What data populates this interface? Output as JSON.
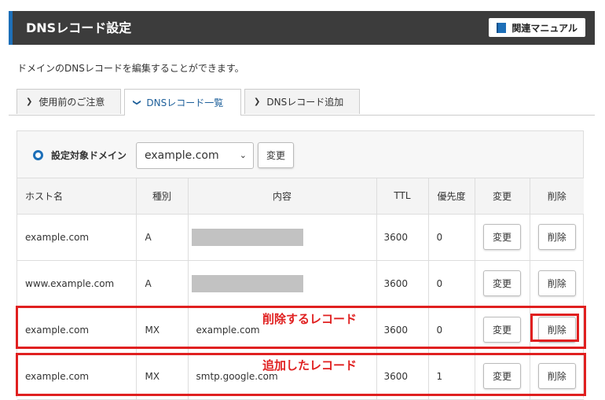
{
  "header": {
    "title": "DNSレコード設定",
    "manual_label": "関連マニュアル"
  },
  "description": "ドメインのDNSレコードを編集することができます。",
  "tabs": [
    {
      "label": "使用前のご注意",
      "active": false
    },
    {
      "label": "DNSレコード一覧",
      "active": true
    },
    {
      "label": "DNSレコード追加",
      "active": false
    }
  ],
  "domain_selector": {
    "label": "設定対象ドメイン",
    "value": "example.com",
    "button_label": "変更"
  },
  "table": {
    "headers": [
      "ホスト名",
      "種別",
      "内容",
      "TTL",
      "優先度",
      "変更",
      "削除"
    ],
    "rows": [
      {
        "host": "example.com",
        "type": "A",
        "content": "",
        "masked": true,
        "ttl": "3600",
        "priority": "0",
        "edit": "変更",
        "delete": "削除"
      },
      {
        "host": "www.example.com",
        "type": "A",
        "content": "",
        "masked": true,
        "ttl": "3600",
        "priority": "0",
        "edit": "変更",
        "delete": "削除"
      },
      {
        "host": "example.com",
        "type": "MX",
        "content": "example.com",
        "masked": false,
        "ttl": "3600",
        "priority": "0",
        "edit": "変更",
        "delete": "削除"
      },
      {
        "host": "example.com",
        "type": "MX",
        "content": "smtp.google.com",
        "masked": false,
        "ttl": "3600",
        "priority": "1",
        "edit": "変更",
        "delete": "削除"
      }
    ]
  },
  "annotations": {
    "delete_record": "削除するレコード",
    "added_record": "追加したレコード",
    "color": "#e02020"
  },
  "colors": {
    "header_bg": "#3c3c3c",
    "accent": "#1d6fb8"
  }
}
